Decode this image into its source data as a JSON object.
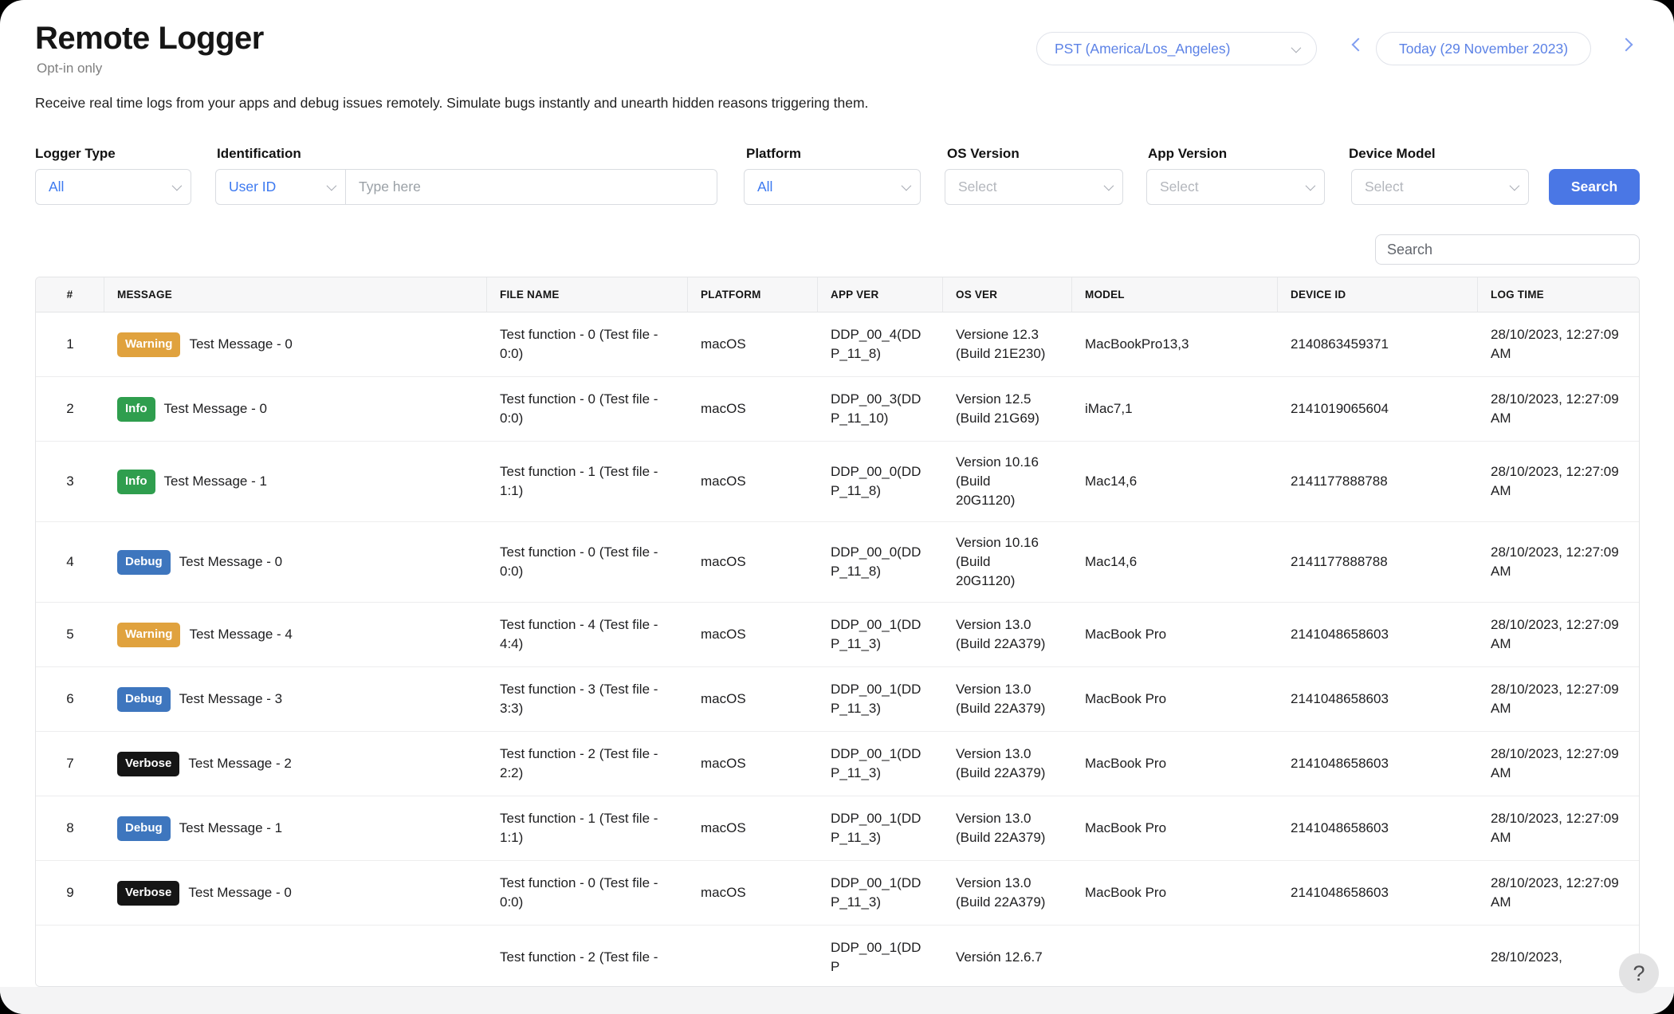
{
  "header": {
    "title": "Remote Logger",
    "subtitle": "Opt-in only",
    "timezone": "PST (America/Los_Angeles)",
    "date": "Today (29 November 2023)"
  },
  "description": "Receive real time logs from your apps and debug issues remotely. Simulate bugs instantly and unearth hidden reasons triggering them.",
  "filters": {
    "logger_type": {
      "label": "Logger Type",
      "value": "All"
    },
    "identification": {
      "label": "Identification",
      "value": "User ID",
      "placeholder": "Type here"
    },
    "platform": {
      "label": "Platform",
      "value": "All"
    },
    "os_version": {
      "label": "OS Version",
      "value": "Select"
    },
    "app_version": {
      "label": "App Version",
      "value": "Select"
    },
    "device_model": {
      "label": "Device Model",
      "value": "Select"
    },
    "search_button": "Search"
  },
  "table": {
    "search_placeholder": "Search",
    "columns": [
      "#",
      "MESSAGE",
      "FILE NAME",
      "PLATFORM",
      "APP VER",
      "OS VER",
      "MODEL",
      "DEVICE ID",
      "LOG TIME"
    ],
    "rows": [
      {
        "n": "1",
        "level": "Warning",
        "message": "Test Message - 0",
        "file": "Test function - 0 (Test file - 0:0)",
        "platform": "macOS",
        "app_ver": "DDP_00_4(DDP_11_8)",
        "os_ver": "Versione 12.3 (Build 21E230)",
        "model": "MacBookPro13,3",
        "device_id": "2140863459371",
        "log_time": "28/10/2023, 12:27:09 AM"
      },
      {
        "n": "2",
        "level": "Info",
        "message": "Test Message - 0",
        "file": "Test function - 0 (Test file - 0:0)",
        "platform": "macOS",
        "app_ver": "DDP_00_3(DDP_11_10)",
        "os_ver": "Version 12.5 (Build 21G69)",
        "model": "iMac7,1",
        "device_id": "2141019065604",
        "log_time": "28/10/2023, 12:27:09 AM"
      },
      {
        "n": "3",
        "level": "Info",
        "message": "Test Message - 1",
        "file": "Test function - 1 (Test file - 1:1)",
        "platform": "macOS",
        "app_ver": "DDP_00_0(DDP_11_8)",
        "os_ver": "Version 10.16 (Build 20G1120)",
        "model": "Mac14,6",
        "device_id": "2141177888788",
        "log_time": "28/10/2023, 12:27:09 AM"
      },
      {
        "n": "4",
        "level": "Debug",
        "message": "Test Message - 0",
        "file": "Test function - 0 (Test file - 0:0)",
        "platform": "macOS",
        "app_ver": "DDP_00_0(DDP_11_8)",
        "os_ver": "Version 10.16 (Build 20G1120)",
        "model": "Mac14,6",
        "device_id": "2141177888788",
        "log_time": "28/10/2023, 12:27:09 AM"
      },
      {
        "n": "5",
        "level": "Warning",
        "message": "Test Message - 4",
        "file": "Test function - 4 (Test file - 4:4)",
        "platform": "macOS",
        "app_ver": "DDP_00_1(DDP_11_3)",
        "os_ver": "Version 13.0 (Build 22A379)",
        "model": "MacBook Pro",
        "device_id": "2141048658603",
        "log_time": "28/10/2023, 12:27:09 AM"
      },
      {
        "n": "6",
        "level": "Debug",
        "message": "Test Message - 3",
        "file": "Test function - 3 (Test file - 3:3)",
        "platform": "macOS",
        "app_ver": "DDP_00_1(DDP_11_3)",
        "os_ver": "Version 13.0 (Build 22A379)",
        "model": "MacBook Pro",
        "device_id": "2141048658603",
        "log_time": "28/10/2023, 12:27:09 AM"
      },
      {
        "n": "7",
        "level": "Verbose",
        "message": "Test Message - 2",
        "file": "Test function - 2 (Test file - 2:2)",
        "platform": "macOS",
        "app_ver": "DDP_00_1(DDP_11_3)",
        "os_ver": "Version 13.0 (Build 22A379)",
        "model": "MacBook Pro",
        "device_id": "2141048658603",
        "log_time": "28/10/2023, 12:27:09 AM"
      },
      {
        "n": "8",
        "level": "Debug",
        "message": "Test Message - 1",
        "file": "Test function - 1 (Test file - 1:1)",
        "platform": "macOS",
        "app_ver": "DDP_00_1(DDP_11_3)",
        "os_ver": "Version 13.0 (Build 22A379)",
        "model": "MacBook Pro",
        "device_id": "2141048658603",
        "log_time": "28/10/2023, 12:27:09 AM"
      },
      {
        "n": "9",
        "level": "Verbose",
        "message": "Test Message - 0",
        "file": "Test function - 0 (Test file - 0:0)",
        "platform": "macOS",
        "app_ver": "DDP_00_1(DDP_11_3)",
        "os_ver": "Version 13.0 (Build 22A379)",
        "model": "MacBook Pro",
        "device_id": "2141048658603",
        "log_time": "28/10/2023, 12:27:09 AM"
      },
      {
        "n": "",
        "level": "",
        "message": "",
        "file": "Test function - 2 (Test file -",
        "platform": "",
        "app_ver": "DDP_00_1(DDP",
        "os_ver": "Versión 12.6.7",
        "model": "",
        "device_id": "",
        "log_time": "28/10/2023,"
      }
    ]
  },
  "badge_colors": {
    "Warning": "#e0a23e",
    "Info": "#2f9e4e",
    "Debug": "#3e76be",
    "Verbose": "#151515"
  },
  "colors": {
    "accent_blue": "#4a77e5",
    "link_blue": "#3c79f0",
    "pill_blue": "#5c82e6"
  },
  "help_button": "?"
}
